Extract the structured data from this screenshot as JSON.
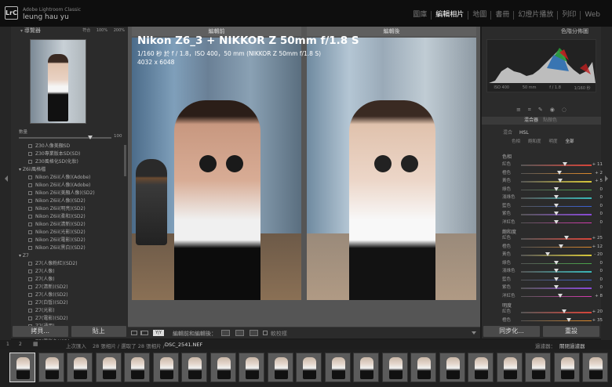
{
  "app": {
    "logo": "LrC",
    "product": "Adobe Lightroom Classic",
    "user": "leung hau yu"
  },
  "modules": [
    {
      "label": "圖庫",
      "active": false
    },
    {
      "label": "編輯相片",
      "active": true
    },
    {
      "label": "地圖",
      "active": false
    },
    {
      "label": "書冊",
      "active": false
    },
    {
      "label": "幻燈片播放",
      "active": false
    },
    {
      "label": "列印",
      "active": false
    },
    {
      "label": "Web",
      "active": false
    }
  ],
  "left": {
    "navigator": {
      "title": "導覽器",
      "fit": "符合",
      "z100": "100%",
      "z200": "200%"
    },
    "amount": {
      "label": "數量",
      "value": "100"
    },
    "presets": [
      {
        "label": "Z30人像美顏SD",
        "indent": 1
      },
      {
        "label": "Z30專業版本SD(SD)",
        "indent": 1
      },
      {
        "label": "Z30風格化SD(化妝)",
        "indent": 1
      },
      {
        "label": "▾ Z6ii風格檔",
        "indent": 0
      },
      {
        "label": "Nikon Z6ii(人像)(Adobe)",
        "indent": 1
      },
      {
        "label": "Nikon Z6ii(人像)(Adobe)",
        "indent": 1
      },
      {
        "label": "Nikon Z6ii(美顏人像)(SD2)",
        "indent": 1
      },
      {
        "label": "Nikon Z6ii(人像)(SD2)",
        "indent": 1
      },
      {
        "label": "Nikon Z6ii(明亮)(SD2)",
        "indent": 1
      },
      {
        "label": "Nikon Z6ii(柔和)(SD2)",
        "indent": 1
      },
      {
        "label": "Nikon Z6ii(清新)(SD2)",
        "indent": 1
      },
      {
        "label": "Nikon Z6ii(光影)(SD2)",
        "indent": 1
      },
      {
        "label": "Nikon Z6ii(電影)(SD2)",
        "indent": 1
      },
      {
        "label": "Nikon Z6ii(黑白)(SD2)",
        "indent": 1
      },
      {
        "label": "▾ Z7",
        "indent": 0
      },
      {
        "label": "Z7(人像粉紅)(SD2)",
        "indent": 1
      },
      {
        "label": "Z7(人像)",
        "indent": 1
      },
      {
        "label": "Z7(人像)",
        "indent": 1
      },
      {
        "label": "Z7(清新)(SD2)",
        "indent": 1
      },
      {
        "label": "Z7(人像)(SD2)",
        "indent": 1
      },
      {
        "label": "Z7(白皙)(SD2)",
        "indent": 1
      },
      {
        "label": "Z7(光影)",
        "indent": 1
      },
      {
        "label": "Z7(電影)(SD2)",
        "indent": 1
      },
      {
        "label": "Z7(通用)",
        "indent": 1
      },
      {
        "label": "Z7(黑白)",
        "indent": 1
      },
      {
        "label": "Z7(電影色)(SD)",
        "indent": 1
      }
    ],
    "copy_btn": "拷貝...",
    "paste_btn": "貼上"
  },
  "center": {
    "camera": "Nikon Z6_3 + NIKKOR Z 50mm f/1.8 S",
    "exif": "1/160 秒 於 f / 1.8，ISO 400，50 mm (NIKKOR Z 50mm f/1.8 S)",
    "dims": "4032 x 6048",
    "before_label": "編輯前",
    "after_label": "編輯後",
    "toolbar": {
      "xy": "Y|Y",
      "compare": "編輯前和編輯後：",
      "softproof": "軟校樣"
    }
  },
  "right": {
    "histogram_title": "色階分佈圖",
    "hist_info": {
      "iso": "ISO 400",
      "focal": "50 mm",
      "aperture": "f / 1.8",
      "shutter": "1/160 秒"
    },
    "panel_tabs": {
      "mixer": "混合器",
      "point": "點顏色"
    },
    "mix_label": "混合",
    "hsl": "HSL",
    "subtabs": [
      "色相",
      "飽和度",
      "明度",
      "全部"
    ],
    "hue_title": "色相",
    "hue": [
      {
        "label": "紅色",
        "value": "+ 11",
        "pos": 0.62
      },
      {
        "label": "橙色",
        "value": "+ 2",
        "pos": 0.54
      },
      {
        "label": "黃色",
        "value": "+ 5",
        "pos": 0.56
      },
      {
        "label": "綠色",
        "value": "0",
        "pos": 0.5
      },
      {
        "label": "淺綠色",
        "value": "0",
        "pos": 0.5
      },
      {
        "label": "藍色",
        "value": "0",
        "pos": 0.5
      },
      {
        "label": "紫色",
        "value": "0",
        "pos": 0.5
      },
      {
        "label": "洋紅色",
        "value": "0",
        "pos": 0.5
      }
    ],
    "sat_title": "飽和度",
    "sat": [
      {
        "label": "紅色",
        "value": "+ 25",
        "pos": 0.64
      },
      {
        "label": "橙色",
        "value": "+ 12",
        "pos": 0.57
      },
      {
        "label": "黃色",
        "value": "- 20",
        "pos": 0.38
      },
      {
        "label": "綠色",
        "value": "0",
        "pos": 0.5
      },
      {
        "label": "淺綠色",
        "value": "0",
        "pos": 0.5
      },
      {
        "label": "藍色",
        "value": "0",
        "pos": 0.5
      },
      {
        "label": "紫色",
        "value": "0",
        "pos": 0.5
      },
      {
        "label": "洋紅色",
        "value": "+ 8",
        "pos": 0.55
      }
    ],
    "lum_title": "明度",
    "lum": [
      {
        "label": "紅色",
        "value": "+ 20",
        "pos": 0.61
      },
      {
        "label": "橙色",
        "value": "+ 35",
        "pos": 0.68
      }
    ],
    "prev_btn": "同步化...",
    "reset_btn": "重設"
  },
  "filmbar": {
    "page1": "1",
    "page2": "2",
    "prev_import": "上次匯入",
    "count": "28 張相片 / 選取了 28 張相片 /",
    "filename": "DSC_2541.NEF",
    "filter_label": "過濾器：",
    "filter_value": "關閉過濾器"
  },
  "film_count": 21,
  "colors": {
    "accent": "#ffffff",
    "panel": "#2b2b2b"
  }
}
